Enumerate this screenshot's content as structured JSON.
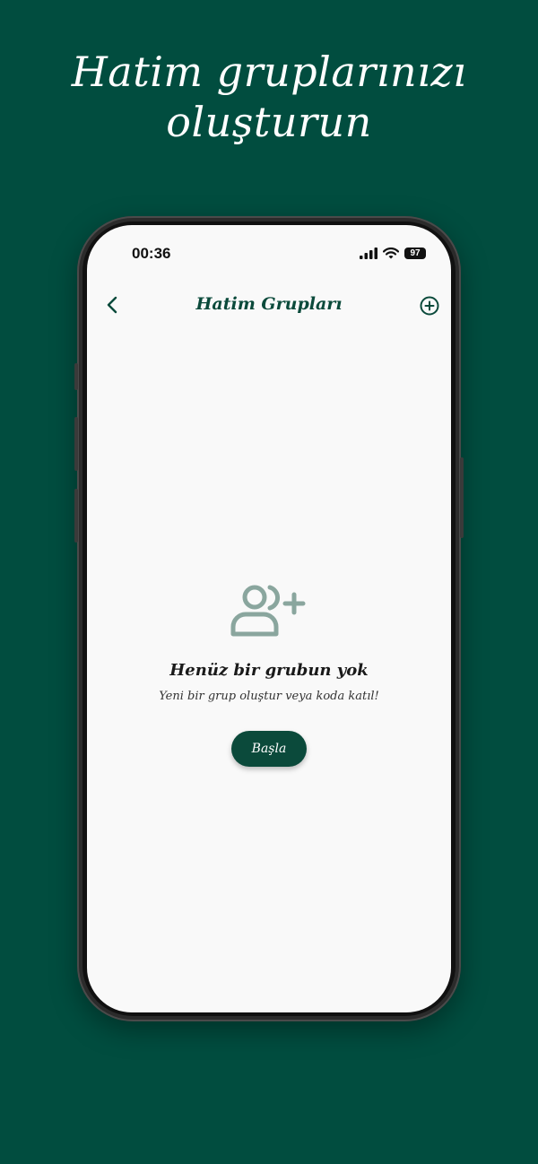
{
  "promo": {
    "headline_line1": "Hatim gruplarınızı",
    "headline_line2": "oluşturun"
  },
  "colors": {
    "background": "#014d3f",
    "accent": "#0b4a3b",
    "icon_muted": "#8aa69e",
    "screen_bg": "#f9f9f9"
  },
  "status_bar": {
    "time": "00:36",
    "battery": "97",
    "icons": [
      "signal-icon",
      "wifi-icon",
      "battery-icon"
    ]
  },
  "nav": {
    "title": "Hatim Grupları",
    "back_icon": "chevron-left-icon",
    "add_icon": "plus-circle-icon"
  },
  "empty_state": {
    "icon": "user-plus-icon",
    "title": "Henüz bir grubun yok",
    "subtitle": "Yeni bir grup oluştur veya koda katıl!",
    "button_label": "Başla"
  }
}
